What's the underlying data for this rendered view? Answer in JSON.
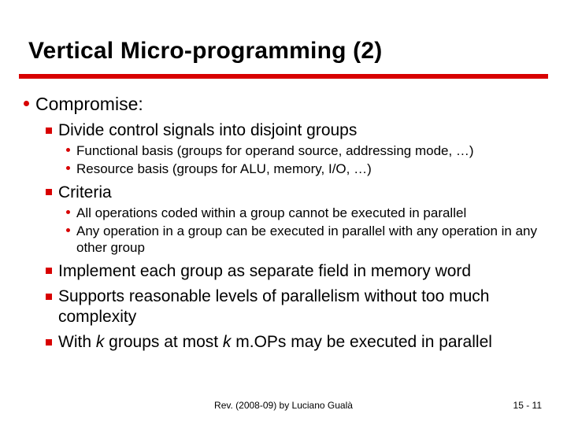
{
  "title": "Vertical Micro-programming (2)",
  "l1_1": "Compromise:",
  "l2_1": "Divide control signals into disjoint groups",
  "l3_1": "Functional basis (groups for operand source, addressing mode, …)",
  "l3_2": "Resource basis (groups for ALU, memory, I/O, …)",
  "l2_2": "Criteria",
  "l3_3": "All operations coded within a group cannot be executed in parallel",
  "l3_4": "Any operation in a group can be executed in parallel with any operation in any other group",
  "l2_3": "Implement each group as separate field in memory word",
  "l2_4": "Supports reasonable levels of parallelism without too much complexity",
  "l2_5_pre": "With ",
  "l2_5_k1": "k",
  "l2_5_mid": " groups at most ",
  "l2_5_k2": "k",
  "l2_5_post": " m.OPs may be executed in parallel",
  "footer_center": "Rev. (2008-09) by Luciano Gualà",
  "footer_right": "15 - 11"
}
